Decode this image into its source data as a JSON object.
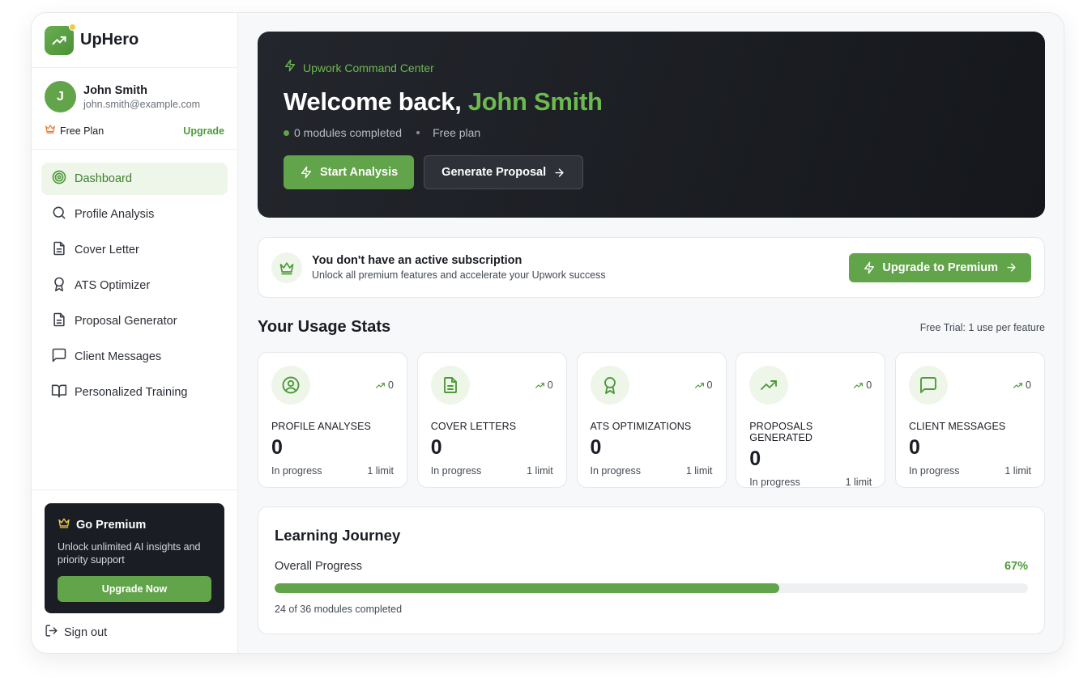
{
  "brand": {
    "name": "UpHero",
    "logo_icon": "trending-up-icon"
  },
  "user": {
    "initial": "J",
    "name": "John Smith",
    "email": "john.smith@example.com",
    "plan_label": "Free Plan",
    "upgrade_label": "Upgrade"
  },
  "nav": {
    "items": [
      {
        "label": "Dashboard",
        "icon": "target-icon",
        "active": true
      },
      {
        "label": "Profile Analysis",
        "icon": "search-icon"
      },
      {
        "label": "Cover Letter",
        "icon": "document-icon"
      },
      {
        "label": "ATS Optimizer",
        "icon": "award-icon"
      },
      {
        "label": "Proposal Generator",
        "icon": "document-icon"
      },
      {
        "label": "Client Messages",
        "icon": "message-icon"
      },
      {
        "label": "Personalized Training",
        "icon": "book-icon"
      }
    ]
  },
  "premium_card": {
    "title": "Go Premium",
    "description": "Unlock unlimited AI insights and priority support",
    "button": "Upgrade Now"
  },
  "signout": {
    "label": "Sign out"
  },
  "hero": {
    "tag": "Upwork Command Center",
    "welcome": "Welcome back, ",
    "name": "John Smith",
    "modules_completed": "0 modules completed",
    "plan": "Free plan",
    "primary_button": "Start Analysis",
    "secondary_button": "Generate Proposal"
  },
  "subscription": {
    "title": "You don't have an active subscription",
    "description": "Unlock all premium features and accelerate your Upwork success",
    "button": "Upgrade to Premium"
  },
  "stats": {
    "title": "Your Usage Stats",
    "note": "Free Trial: 1 use per feature",
    "cards": [
      {
        "icon": "user-circle-icon",
        "trend": "0",
        "label": "PROFILE ANALYSES",
        "value": "0",
        "status": "In progress",
        "limit": "1 limit"
      },
      {
        "icon": "document-icon",
        "trend": "0",
        "label": "COVER LETTERS",
        "value": "0",
        "status": "In progress",
        "limit": "1 limit"
      },
      {
        "icon": "award-icon",
        "trend": "0",
        "label": "ATS OPTIMIZATIONS",
        "value": "0",
        "status": "In progress",
        "limit": "1 limit"
      },
      {
        "icon": "trending-up-icon",
        "trend": "0",
        "label": "PROPOSALS GENERATED",
        "value": "0",
        "status": "In progress",
        "limit": "1 limit"
      },
      {
        "icon": "message-icon",
        "trend": "0",
        "label": "CLIENT MESSAGES",
        "value": "0",
        "status": "In progress",
        "limit": "1 limit"
      }
    ]
  },
  "learning": {
    "title": "Learning Journey",
    "progress_label": "Overall Progress",
    "progress_percent": "67%",
    "progress_value": 0.67,
    "footer": "24 of 36 modules completed"
  },
  "colors": {
    "accent": "#62a44a",
    "accent_text": "#4f9a3a",
    "dark": "#1a1d23",
    "premium_gold": "#f6c945",
    "crown_orange": "#e8772e"
  }
}
